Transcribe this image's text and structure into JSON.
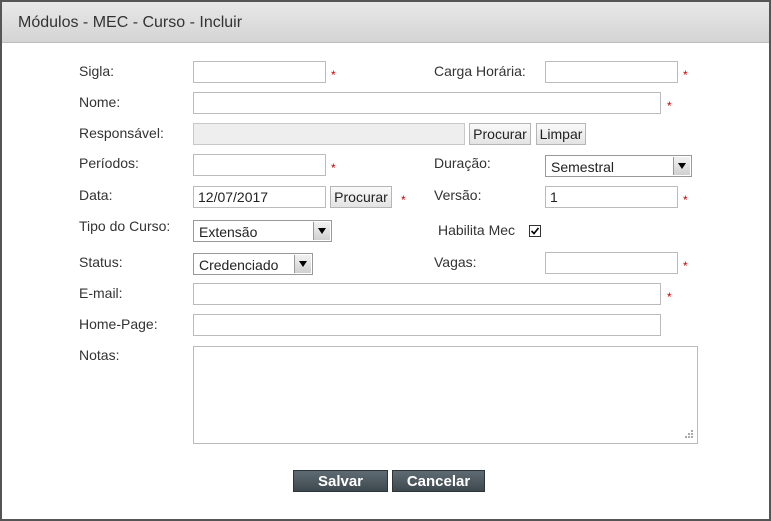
{
  "window": {
    "title": "Módulos - MEC - Curso - Incluir"
  },
  "required_mark": "*",
  "form": {
    "sigla": {
      "label": "Sigla:",
      "value": ""
    },
    "carga_horaria": {
      "label": "Carga Horária:",
      "value": ""
    },
    "nome": {
      "label": "Nome:",
      "value": ""
    },
    "responsavel": {
      "label": "Responsável:",
      "value": "",
      "search_button": "Procurar",
      "clear_button": "Limpar"
    },
    "periodos": {
      "label": "Períodos:",
      "value": ""
    },
    "duracao": {
      "label": "Duração:",
      "value": "Semestral"
    },
    "data": {
      "label": "Data:",
      "value": "12/07/2017",
      "search_button": "Procurar"
    },
    "versao": {
      "label": "Versão:",
      "value": "1"
    },
    "tipo_curso": {
      "label": "Tipo do Curso:",
      "value": "Extensão"
    },
    "habilita_mec": {
      "label": "Habilita Mec",
      "checked": true
    },
    "status": {
      "label": "Status:",
      "value": "Credenciado"
    },
    "vagas": {
      "label": "Vagas:",
      "value": ""
    },
    "email": {
      "label": "E-mail:",
      "value": ""
    },
    "home_page": {
      "label": "Home-Page:",
      "value": ""
    },
    "notas": {
      "label": "Notas:",
      "value": ""
    }
  },
  "actions": {
    "save_label": "Salvar",
    "cancel_label": "Cancelar"
  },
  "colors": {
    "required": "#cc0000",
    "action_button": "#4a545b"
  }
}
